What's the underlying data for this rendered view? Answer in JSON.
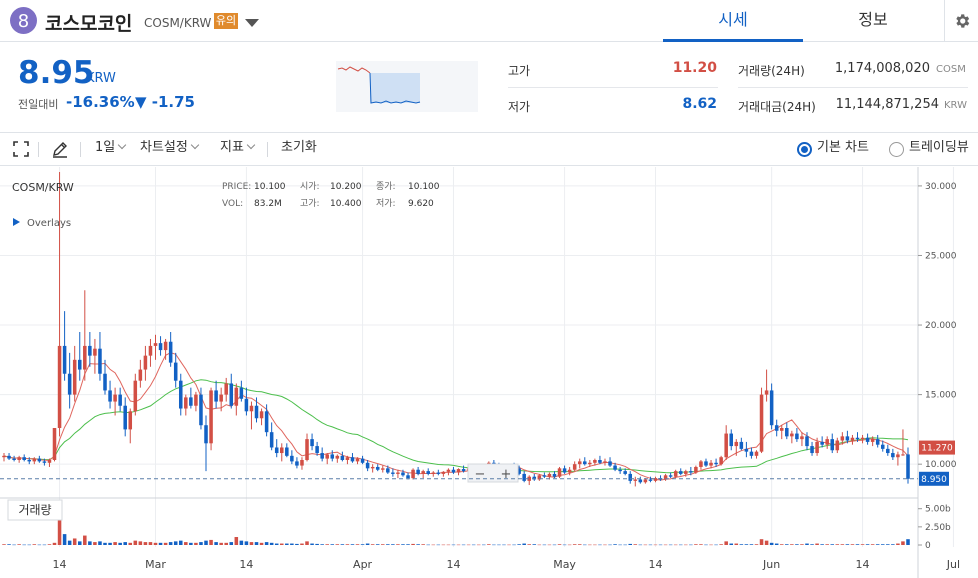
{
  "header": {
    "coin_name": "코스모코인",
    "pair": "COSM/KRW",
    "warning_badge": "유의",
    "tabs": [
      {
        "label": "시세"
      },
      {
        "label": "정보"
      }
    ]
  },
  "summary": {
    "price": "8.95",
    "price_unit": "KRW",
    "change_label": "전일대비",
    "change_rate": "-16.36%",
    "change_amount": "▼ -1.75",
    "high_label": "고가",
    "high_value": "11.20",
    "low_label": "저가",
    "low_value": "8.62",
    "volume_label": "거래량(24H)",
    "volume_value": "1,174,008,020",
    "volume_unit": "COSM",
    "amount_label": "거래대금(24H)",
    "amount_value": "11,144,871,254",
    "amount_unit": "KRW",
    "colors": {
      "up": "#d24f45",
      "down": "#1261c4"
    }
  },
  "toolbar": {
    "interval": "1일",
    "chart_settings": "차트설정",
    "indicators": "지표",
    "reset": "초기화",
    "basic_chart": "기본 차트",
    "tradingview": "트레이딩뷰"
  },
  "chart_info": {
    "symbol": "COSM/KRW",
    "overlays": "Overlays",
    "price_label": "PRICE:",
    "price_value": "10.100",
    "open_label": "시가:",
    "open_value": "10.200",
    "close_label": "종가:",
    "close_value": "10.100",
    "vol_label": "VOL:",
    "vol_value": "83.2M",
    "high_label": "고가:",
    "high_value": "10.400",
    "low_label": "저가:",
    "low_value": "9.620",
    "volume_pane_label": "거래량",
    "zoom_out": "−",
    "zoom_in": "+",
    "ma_short_label": "11.270",
    "last_price_label": "8.950"
  },
  "chart_data": {
    "type": "candlestick",
    "y_axis_ticks": [
      "30.000",
      "25.000",
      "20.000",
      "15.000",
      "10.000"
    ],
    "y_range": [
      8.0,
      31.0
    ],
    "volume_ticks": [
      "5.00b",
      "2.50b",
      "0"
    ],
    "volume_range": [
      0,
      6.2
    ],
    "x_ticks": [
      {
        "label": "14",
        "i": 11
      },
      {
        "label": "Mar",
        "i": 30
      },
      {
        "label": "14",
        "i": 48
      },
      {
        "label": "Apr",
        "i": 71
      },
      {
        "label": "14",
        "i": 89
      },
      {
        "label": "May",
        "i": 111
      },
      {
        "label": "14",
        "i": 129
      },
      {
        "label": "Jun",
        "i": 152
      },
      {
        "label": "14",
        "i": 170
      },
      {
        "label": "Jul",
        "i": 188
      }
    ],
    "candles": [
      [
        10.5,
        10.8,
        10.2,
        10.6
      ],
      [
        10.6,
        10.8,
        10.3,
        10.4
      ],
      [
        10.4,
        10.6,
        10.2,
        10.3
      ],
      [
        10.3,
        10.6,
        10.1,
        10.5
      ],
      [
        10.5,
        10.7,
        10.2,
        10.3
      ],
      [
        10.3,
        10.5,
        10.0,
        10.2
      ],
      [
        10.2,
        10.5,
        10.0,
        10.4
      ],
      [
        10.4,
        10.6,
        10.1,
        10.2
      ],
      [
        10.2,
        10.4,
        9.9,
        10.1
      ],
      [
        10.1,
        10.4,
        9.8,
        10.3
      ],
      [
        10.3,
        12.0,
        10.2,
        12.6
      ],
      [
        12.6,
        31.0,
        12.0,
        18.5
      ],
      [
        18.5,
        21.0,
        16.0,
        16.5
      ],
      [
        16.5,
        18.0,
        14.0,
        15.0
      ],
      [
        15.0,
        18.5,
        14.5,
        17.5
      ],
      [
        17.5,
        19.5,
        16.0,
        16.8
      ],
      [
        16.8,
        22.5,
        16.0,
        18.5
      ],
      [
        18.5,
        19.5,
        17.0,
        17.8
      ],
      [
        17.8,
        19.0,
        16.5,
        18.3
      ],
      [
        18.3,
        19.5,
        16.0,
        16.5
      ],
      [
        16.5,
        17.5,
        15.0,
        15.3
      ],
      [
        15.3,
        16.0,
        14.0,
        14.5
      ],
      [
        14.5,
        15.5,
        13.5,
        15.0
      ],
      [
        15.0,
        15.5,
        13.8,
        14.2
      ],
      [
        14.2,
        14.8,
        12.0,
        12.5
      ],
      [
        12.5,
        14.0,
        11.5,
        13.8
      ],
      [
        13.8,
        16.5,
        13.5,
        16.0
      ],
      [
        16.0,
        17.5,
        15.5,
        16.8
      ],
      [
        16.8,
        18.5,
        16.0,
        17.8
      ],
      [
        17.8,
        19.0,
        17.0,
        18.5
      ],
      [
        18.5,
        19.3,
        17.5,
        18.7
      ],
      [
        18.7,
        19.2,
        17.8,
        18.2
      ],
      [
        18.2,
        19.0,
        17.5,
        18.8
      ],
      [
        18.8,
        19.5,
        17.0,
        17.3
      ],
      [
        17.3,
        18.0,
        15.5,
        16.0
      ],
      [
        16.0,
        16.5,
        13.5,
        14.0
      ],
      [
        14.0,
        15.0,
        13.5,
        14.8
      ],
      [
        14.8,
        15.5,
        14.0,
        14.2
      ],
      [
        14.2,
        15.2,
        13.8,
        15.0
      ],
      [
        15.0,
        15.5,
        12.5,
        12.8
      ],
      [
        12.8,
        13.5,
        9.5,
        11.5
      ],
      [
        11.5,
        15.5,
        11.0,
        15.3
      ],
      [
        15.3,
        16.0,
        14.0,
        14.5
      ],
      [
        14.5,
        15.5,
        13.8,
        15.0
      ],
      [
        15.0,
        16.2,
        14.5,
        15.8
      ],
      [
        15.8,
        16.5,
        14.0,
        14.2
      ],
      [
        14.2,
        15.8,
        13.5,
        15.5
      ],
      [
        15.5,
        16.0,
        14.5,
        14.7
      ],
      [
        14.7,
        15.5,
        13.5,
        13.8
      ],
      [
        13.8,
        14.5,
        12.5,
        14.2
      ],
      [
        14.2,
        14.8,
        13.0,
        13.3
      ],
      [
        13.3,
        14.0,
        12.8,
        13.8
      ],
      [
        13.8,
        14.3,
        12.0,
        12.3
      ],
      [
        12.3,
        13.0,
        11.0,
        11.2
      ],
      [
        11.2,
        11.8,
        10.5,
        10.8
      ],
      [
        10.8,
        11.5,
        10.2,
        11.2
      ],
      [
        11.2,
        11.5,
        10.5,
        10.6
      ],
      [
        10.6,
        11.0,
        10.0,
        10.2
      ],
      [
        10.2,
        10.5,
        9.7,
        9.9
      ],
      [
        9.9,
        10.5,
        9.6,
        10.3
      ],
      [
        10.3,
        12.2,
        10.2,
        11.8
      ],
      [
        11.8,
        12.2,
        11.0,
        11.3
      ],
      [
        11.3,
        11.6,
        10.6,
        10.8
      ],
      [
        10.8,
        11.2,
        10.2,
        10.4
      ],
      [
        10.4,
        10.8,
        10.0,
        10.7
      ],
      [
        10.7,
        11.0,
        10.2,
        10.4
      ],
      [
        10.4,
        10.7,
        10.1,
        10.6
      ],
      [
        10.6,
        10.9,
        10.2,
        10.3
      ],
      [
        10.3,
        10.6,
        10.0,
        10.5
      ],
      [
        10.5,
        10.8,
        10.1,
        10.2
      ],
      [
        10.2,
        10.5,
        10.0,
        10.4
      ],
      [
        10.4,
        10.6,
        10.0,
        10.1
      ],
      [
        10.1,
        10.3,
        9.5,
        9.7
      ],
      [
        9.7,
        10.0,
        9.4,
        9.8
      ],
      [
        9.8,
        10.0,
        9.5,
        9.6
      ],
      [
        9.6,
        9.9,
        9.4,
        9.7
      ],
      [
        9.7,
        9.9,
        9.3,
        9.4
      ],
      [
        9.4,
        9.7,
        9.1,
        9.3
      ],
      [
        9.3,
        9.6,
        9.0,
        9.4
      ],
      [
        9.4,
        9.6,
        9.1,
        9.2
      ],
      [
        9.2,
        9.4,
        8.9,
        9.0
      ],
      [
        9.0,
        9.7,
        8.9,
        9.6
      ],
      [
        9.6,
        9.8,
        9.2,
        9.3
      ],
      [
        9.3,
        9.6,
        9.0,
        9.5
      ],
      [
        9.5,
        9.7,
        9.2,
        9.3
      ],
      [
        9.3,
        9.5,
        9.1,
        9.4
      ],
      [
        9.4,
        9.6,
        9.2,
        9.3
      ],
      [
        9.3,
        9.5,
        9.1,
        9.45
      ],
      [
        9.45,
        9.7,
        9.2,
        9.6
      ],
      [
        9.6,
        9.8,
        9.3,
        9.4
      ],
      [
        9.4,
        9.7,
        9.2,
        9.65
      ],
      [
        9.65,
        9.9,
        9.4,
        9.5
      ],
      [
        9.5,
        9.8,
        9.3,
        9.7
      ],
      [
        9.7,
        9.9,
        9.4,
        9.55
      ],
      [
        9.55,
        9.8,
        9.3,
        9.75
      ],
      [
        9.75,
        10.0,
        9.5,
        9.6
      ],
      [
        9.6,
        10.2,
        9.5,
        10.1
      ],
      [
        10.1,
        10.3,
        9.8,
        9.9
      ],
      [
        9.9,
        10.1,
        9.6,
        9.8
      ],
      [
        9.8,
        10.0,
        9.5,
        9.7
      ],
      [
        9.7,
        10.0,
        9.5,
        9.9
      ],
      [
        9.9,
        10.1,
        9.6,
        9.7
      ],
      [
        9.7,
        9.9,
        9.2,
        9.3
      ],
      [
        9.3,
        9.5,
        8.7,
        8.8
      ],
      [
        8.8,
        9.2,
        8.5,
        9.1
      ],
      [
        9.1,
        9.3,
        8.8,
        8.9
      ],
      [
        8.9,
        9.3,
        8.8,
        9.2
      ],
      [
        9.2,
        9.4,
        9.0,
        9.1
      ],
      [
        9.1,
        9.4,
        8.9,
        9.3
      ],
      [
        9.3,
        9.5,
        9.0,
        9.1
      ],
      [
        9.1,
        9.8,
        9.0,
        9.7
      ],
      [
        9.7,
        9.9,
        9.3,
        9.4
      ],
      [
        9.4,
        9.8,
        9.2,
        9.6
      ],
      [
        9.6,
        10.2,
        9.5,
        10.0
      ],
      [
        10.0,
        10.4,
        9.7,
        10.2
      ],
      [
        10.2,
        10.5,
        9.9,
        10.0
      ],
      [
        10.0,
        10.3,
        9.8,
        10.1
      ],
      [
        10.1,
        10.4,
        9.9,
        10.3
      ],
      [
        10.3,
        10.6,
        10.0,
        10.1
      ],
      [
        10.1,
        10.4,
        9.9,
        10.2
      ],
      [
        10.2,
        10.5,
        9.8,
        9.9
      ],
      [
        9.9,
        10.1,
        9.5,
        9.6
      ],
      [
        9.6,
        9.8,
        9.3,
        9.5
      ],
      [
        9.5,
        9.7,
        9.2,
        9.3
      ],
      [
        9.3,
        9.5,
        8.6,
        8.8
      ],
      [
        8.8,
        9.1,
        8.4,
        8.9
      ],
      [
        8.9,
        9.1,
        8.6,
        8.7
      ],
      [
        8.7,
        9.0,
        8.6,
        8.9
      ],
      [
        8.9,
        9.1,
        8.7,
        8.8
      ],
      [
        8.8,
        9.1,
        8.7,
        9.0
      ],
      [
        9.0,
        9.2,
        8.8,
        8.9
      ],
      [
        8.9,
        9.3,
        8.8,
        9.2
      ],
      [
        9.2,
        9.4,
        9.0,
        9.1
      ],
      [
        9.1,
        9.6,
        9.0,
        9.5
      ],
      [
        9.5,
        9.7,
        9.2,
        9.3
      ],
      [
        9.3,
        9.6,
        9.1,
        9.5
      ],
      [
        9.5,
        9.8,
        9.2,
        9.4
      ],
      [
        9.4,
        9.9,
        9.3,
        9.8
      ],
      [
        9.8,
        10.3,
        9.6,
        10.2
      ],
      [
        10.2,
        10.4,
        9.8,
        9.9
      ],
      [
        9.9,
        10.3,
        9.7,
        10.1
      ],
      [
        10.1,
        10.4,
        9.8,
        10.0
      ],
      [
        10.0,
        10.6,
        9.9,
        10.5
      ],
      [
        10.5,
        12.8,
        10.3,
        12.2
      ],
      [
        12.2,
        12.5,
        11.0,
        11.3
      ],
      [
        11.3,
        11.8,
        10.6,
        11.6
      ],
      [
        11.6,
        11.9,
        11.0,
        11.1
      ],
      [
        11.1,
        11.6,
        10.5,
        10.9
      ],
      [
        10.9,
        11.2,
        10.4,
        10.6
      ],
      [
        10.6,
        11.0,
        10.4,
        10.9
      ],
      [
        10.9,
        15.5,
        10.8,
        15.0
      ],
      [
        15.0,
        16.8,
        14.5,
        15.3
      ],
      [
        15.3,
        15.8,
        12.5,
        12.8
      ],
      [
        12.8,
        13.2,
        12.0,
        12.4
      ],
      [
        12.4,
        12.8,
        11.8,
        12.6
      ],
      [
        12.6,
        13.0,
        11.8,
        12.0
      ],
      [
        12.0,
        12.4,
        11.5,
        12.2
      ],
      [
        12.2,
        12.6,
        11.6,
        11.8
      ],
      [
        11.8,
        12.3,
        11.3,
        12.0
      ],
      [
        12.0,
        12.3,
        11.0,
        11.3
      ],
      [
        11.3,
        11.6,
        10.6,
        10.8
      ],
      [
        10.8,
        11.9,
        10.6,
        11.6
      ],
      [
        11.6,
        12.0,
        11.2,
        11.4
      ],
      [
        11.4,
        12.0,
        11.1,
        11.8
      ],
      [
        11.8,
        12.2,
        10.8,
        11.0
      ],
      [
        11.0,
        11.9,
        10.8,
        11.7
      ],
      [
        11.7,
        12.3,
        11.4,
        12.0
      ],
      [
        12.0,
        12.4,
        11.5,
        11.7
      ],
      [
        11.7,
        12.1,
        11.4,
        11.9
      ],
      [
        11.9,
        12.3,
        11.6,
        11.8
      ],
      [
        11.8,
        12.1,
        11.5,
        11.9
      ],
      [
        11.9,
        12.2,
        11.4,
        11.6
      ],
      [
        11.6,
        12.0,
        11.3,
        11.8
      ],
      [
        11.8,
        12.1,
        11.2,
        11.4
      ],
      [
        11.4,
        11.7,
        10.9,
        11.1
      ],
      [
        11.1,
        11.4,
        10.6,
        10.8
      ],
      [
        10.8,
        11.1,
        10.3,
        10.5
      ],
      [
        10.5,
        10.9,
        9.9,
        10.7
      ],
      [
        10.7,
        12.5,
        10.6,
        10.7
      ],
      [
        10.7,
        11.2,
        8.6,
        8.95
      ]
    ],
    "volumes": [
      0.1,
      0.1,
      0.05,
      0.1,
      0.05,
      0.05,
      0.1,
      0.05,
      0.05,
      0.1,
      0.3,
      5.6,
      1.5,
      0.6,
      0.9,
      0.5,
      1.3,
      0.5,
      0.4,
      0.5,
      0.3,
      0.3,
      0.4,
      0.3,
      0.4,
      0.3,
      0.6,
      0.5,
      0.4,
      0.4,
      0.3,
      0.3,
      0.3,
      0.4,
      0.5,
      0.6,
      0.4,
      0.3,
      0.3,
      0.4,
      0.6,
      0.7,
      0.4,
      0.3,
      0.3,
      0.4,
      1.1,
      0.6,
      0.5,
      0.4,
      0.4,
      0.3,
      0.4,
      0.3,
      0.2,
      0.2,
      0.2,
      0.2,
      0.15,
      0.2,
      0.5,
      0.2,
      0.15,
      0.1,
      0.1,
      0.1,
      0.1,
      0.1,
      0.1,
      0.1,
      0.1,
      0.1,
      0.2,
      0.1,
      0.1,
      0.1,
      0.1,
      0.1,
      0.1,
      0.1,
      0.1,
      0.15,
      0.1,
      0.1,
      0.05,
      0.05,
      0.05,
      0.05,
      0.05,
      0.05,
      0.05,
      0.05,
      0.05,
      0.05,
      0.05,
      0.05,
      0.1,
      0.05,
      0.05,
      0.05,
      0.05,
      0.05,
      0.1,
      0.2,
      0.1,
      0.1,
      0.05,
      0.05,
      0.05,
      0.05,
      0.1,
      0.05,
      0.05,
      0.1,
      0.1,
      0.05,
      0.05,
      0.05,
      0.05,
      0.05,
      0.05,
      0.1,
      0.05,
      0.05,
      0.15,
      0.1,
      0.05,
      0.05,
      0.05,
      0.05,
      0.05,
      0.05,
      0.05,
      0.05,
      0.05,
      0.05,
      0.05,
      0.1,
      0.1,
      0.05,
      0.05,
      0.05,
      0.1,
      0.5,
      0.2,
      0.2,
      0.1,
      0.1,
      0.1,
      0.1,
      0.8,
      0.6,
      0.3,
      0.2,
      0.1,
      0.1,
      0.1,
      0.1,
      0.1,
      0.2,
      0.1,
      0.2,
      0.1,
      0.1,
      0.1,
      0.1,
      0.1,
      0.1,
      0.1,
      0.1,
      0.1,
      0.1,
      0.1,
      0.1,
      0.1,
      0.1,
      0.1,
      0.2,
      0.5,
      0.8
    ]
  }
}
